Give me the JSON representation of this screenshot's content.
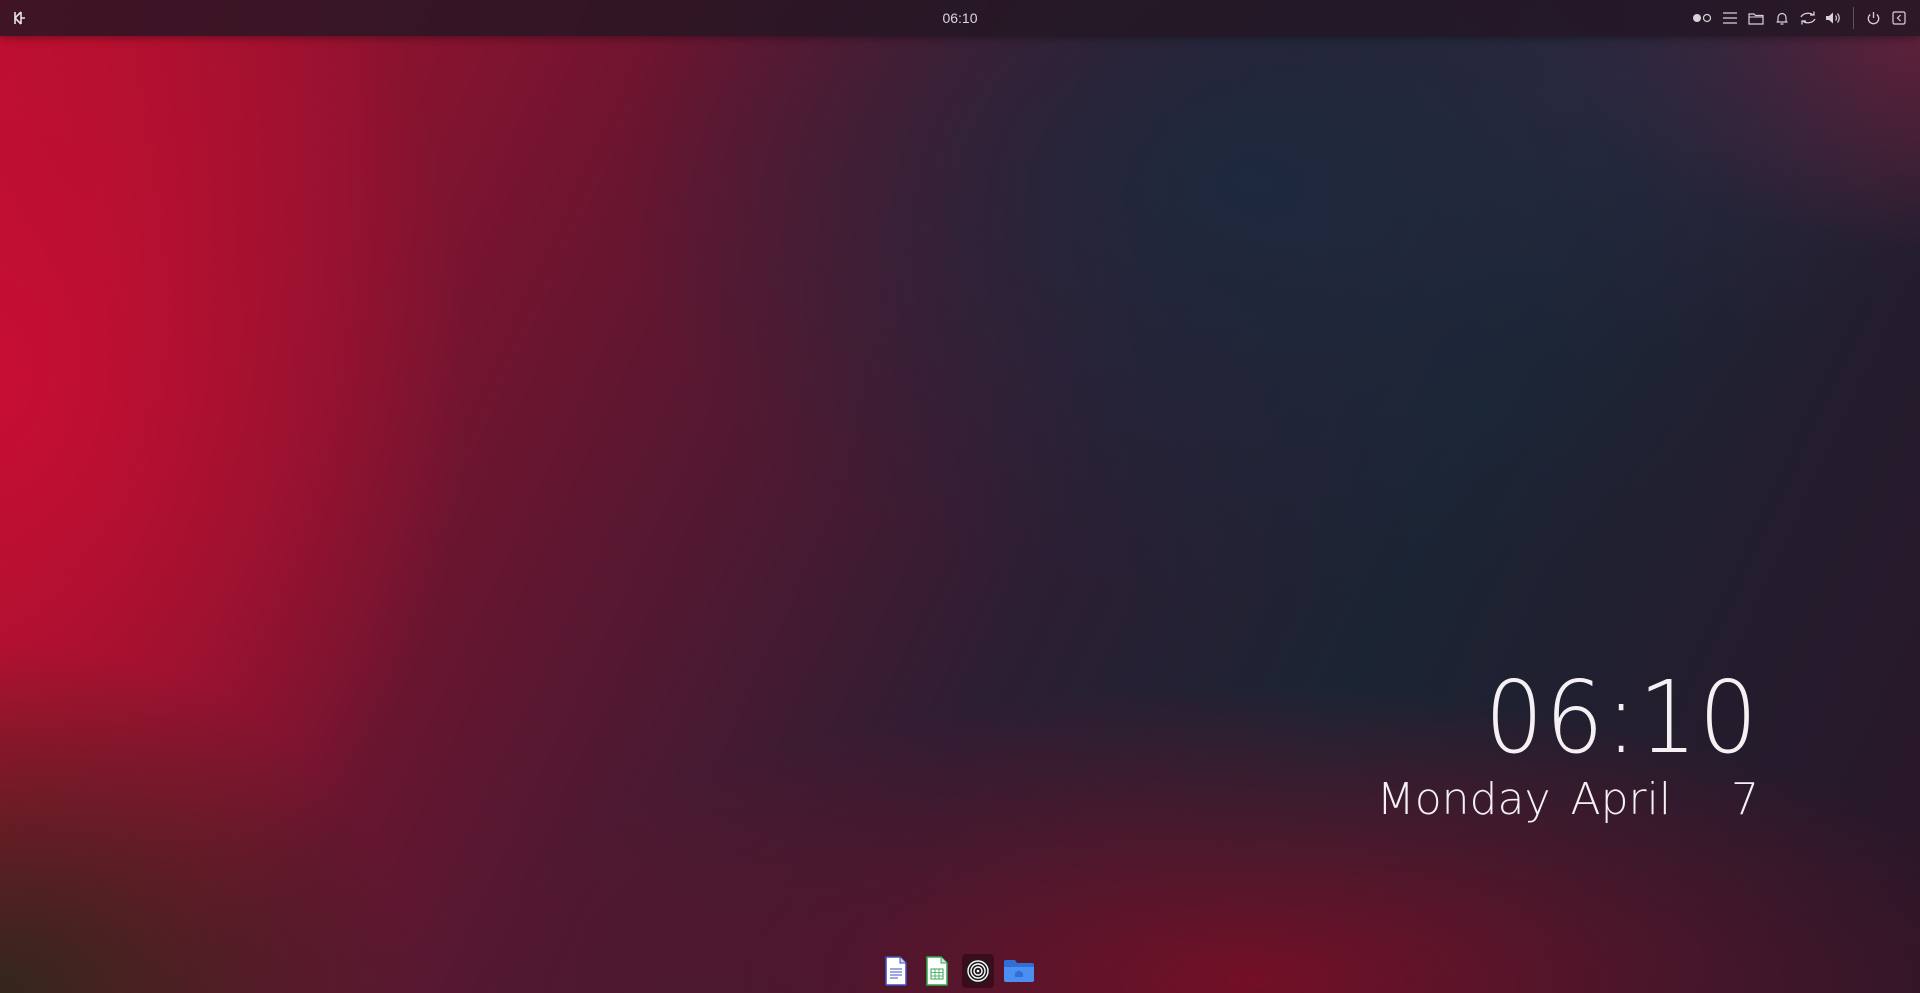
{
  "top_panel": {
    "clock": "06:10",
    "launcher_icon": "kde-launcher-icon",
    "tray_icons": [
      "activities-pager-icon",
      "menu-icon",
      "folder-icon",
      "notification-bell-icon",
      "network-sync-icon",
      "volume-icon",
      "power-icon",
      "window-menu-icon"
    ]
  },
  "clock_widget": {
    "time": "06:10",
    "date": "Monday April   7"
  },
  "dock": {
    "apps": [
      {
        "name": "libreoffice-writer-icon",
        "active": false
      },
      {
        "name": "libreoffice-calc-icon",
        "active": false
      },
      {
        "name": "disk-usage-icon",
        "active": true
      },
      {
        "name": "file-manager-icon",
        "active": false
      }
    ]
  },
  "colors": {
    "panel_bg": "#231623",
    "accent_red": "#b8102e",
    "text": "#f4f0f4"
  }
}
